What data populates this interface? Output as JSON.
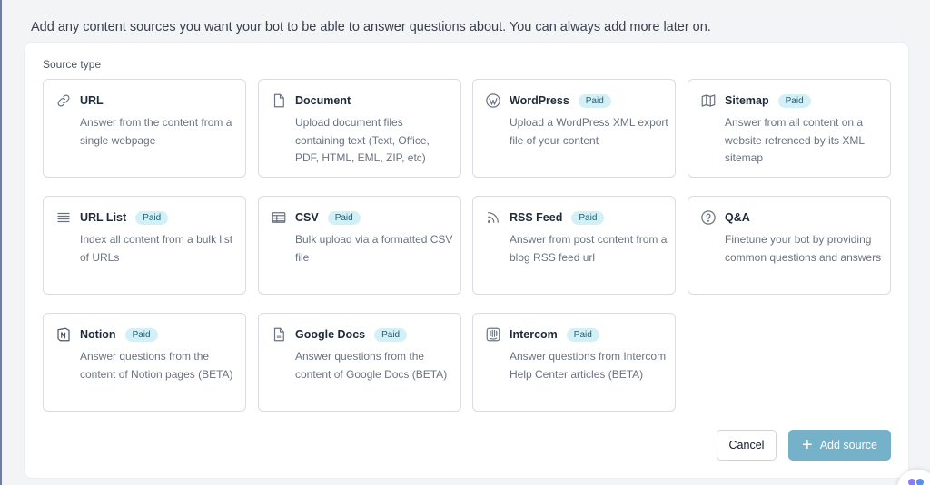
{
  "intro": "Add any content sources you want your bot to be able to answer questions about. You can always add more later on.",
  "source_type_label": "Source type",
  "badge_label": "Paid",
  "cards": [
    {
      "title": "URL",
      "desc": "Answer from the content from a single webpage",
      "paid": false,
      "icon": "link-icon"
    },
    {
      "title": "Document",
      "desc": "Upload document files containing text (Text, Office, PDF, HTML, EML, ZIP, etc)",
      "paid": false,
      "icon": "document-icon"
    },
    {
      "title": "WordPress",
      "desc": "Upload a WordPress XML export file of your content",
      "paid": true,
      "icon": "wordpress-icon"
    },
    {
      "title": "Sitemap",
      "desc": "Answer from all content on a website refrenced by its XML sitemap",
      "paid": true,
      "icon": "map-icon"
    },
    {
      "title": "URL List",
      "desc": "Index all content from a bulk list of URLs",
      "paid": true,
      "icon": "list-icon"
    },
    {
      "title": "CSV",
      "desc": "Bulk upload via a formatted CSV file",
      "paid": true,
      "icon": "table-icon"
    },
    {
      "title": "RSS Feed",
      "desc": "Answer from post content from a blog RSS feed url",
      "paid": true,
      "icon": "rss-icon"
    },
    {
      "title": "Q&A",
      "desc": "Finetune your bot by providing common questions and answers",
      "paid": false,
      "icon": "question-icon"
    },
    {
      "title": "Notion",
      "desc": "Answer questions from the content of Notion pages (BETA)",
      "paid": true,
      "icon": "notion-icon"
    },
    {
      "title": "Google Docs",
      "desc": "Answer questions from the content of Google Docs (BETA)",
      "paid": true,
      "icon": "google-docs-icon"
    },
    {
      "title": "Intercom",
      "desc": "Answer questions from Intercom Help Center articles (BETA)",
      "paid": true,
      "icon": "intercom-icon"
    }
  ],
  "buttons": {
    "cancel": "Cancel",
    "add_source": "Add source"
  },
  "colors": {
    "badge_bg": "#d3f0f7",
    "primary_button": "#76b1ca"
  }
}
